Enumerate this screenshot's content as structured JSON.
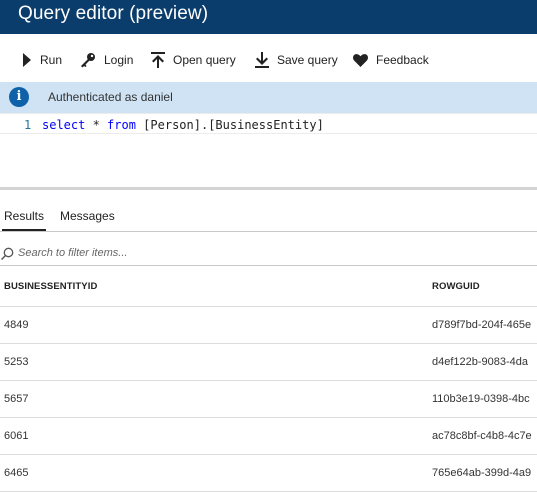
{
  "window": {
    "title": "Query editor (preview)"
  },
  "toolbar": {
    "run_label": "Run",
    "login_label": "Login",
    "open_query_label": "Open query",
    "save_query_label": "Save query",
    "feedback_label": "Feedback"
  },
  "info_bar": {
    "message": "Authenticated as daniel",
    "icon": "info-icon"
  },
  "editor": {
    "line_number": "1",
    "code": {
      "kw_select": "select",
      "star": " * ",
      "kw_from": "from",
      "rest": " [Person].[BusinessEntity]"
    }
  },
  "results_tabs": {
    "results_label": "Results",
    "messages_label": "Messages"
  },
  "filter": {
    "placeholder": "Search to filter items..."
  },
  "table": {
    "columns": [
      "BUSINESSENTITYID",
      "ROWGUID"
    ],
    "rows": [
      [
        "4849",
        "d789f7bd-204f-465e"
      ],
      [
        "5253",
        "d4ef122b-9083-4da"
      ],
      [
        "5657",
        "110b3e19-0398-4bc"
      ],
      [
        "6061",
        "ac78c8bf-c4b8-4c7e"
      ],
      [
        "6465",
        "765e64ab-399d-4a9"
      ]
    ]
  },
  "colors": {
    "title_bar": "#0a3d6b",
    "info_bar": "#cfe3f4",
    "info_icon": "#0f62a8",
    "keyword": "#0000ff",
    "line_number": "#237893"
  }
}
